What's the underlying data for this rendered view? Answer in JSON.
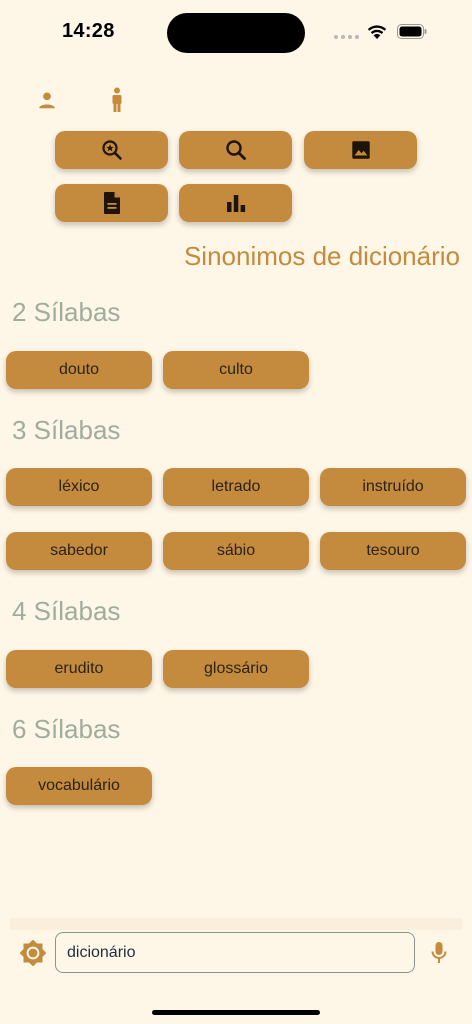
{
  "status_bar": {
    "time": "14:28"
  },
  "toolbar": {
    "buttons": [
      {
        "icon": "zoom-star-icon"
      },
      {
        "icon": "search-icon"
      },
      {
        "icon": "image-icon"
      },
      {
        "icon": "document-icon"
      },
      {
        "icon": "bar-chart-icon"
      }
    ]
  },
  "page_title": "Sinonimos de dicionário",
  "sections": [
    {
      "heading": "2 Sílabas",
      "words": [
        "douto",
        "culto"
      ]
    },
    {
      "heading": "3 Sílabas",
      "words": [
        "léxico",
        "letrado",
        "instruído",
        "sabedor",
        "sábio",
        "tesouro"
      ]
    },
    {
      "heading": "4 Sílabas",
      "words": [
        "erudito",
        "glossário"
      ]
    },
    {
      "heading": "6 Sílabas",
      "words": [
        "vocabulário"
      ]
    }
  ],
  "search": {
    "value": "dicionário"
  },
  "colors": {
    "background": "#FEF6E6",
    "accent": "#C48A3E",
    "heading": "#9FAD9E",
    "icon": "#1E1408"
  }
}
